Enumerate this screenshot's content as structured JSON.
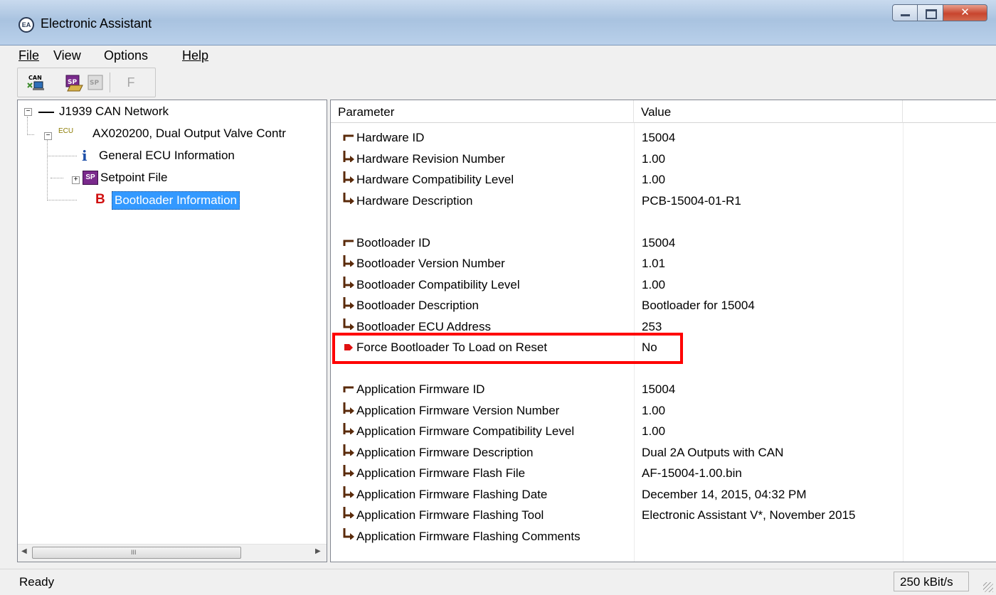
{
  "window": {
    "title": "Electronic Assistant",
    "icon_label": "EA"
  },
  "menu": {
    "file": "File",
    "view": "View",
    "options": "Options",
    "help": "Help"
  },
  "toolbar": {
    "can_label": "CAN",
    "sp_label": "SP",
    "sp_disabled_label": "SP",
    "flash_label": "F"
  },
  "tree": {
    "network": "J1939 CAN Network",
    "ecu_prefix": "ECU",
    "ecu": "AX020200, Dual Output Valve Contr",
    "general_info": "General ECU Information",
    "general_info_icon": "i",
    "setpoint_file": "Setpoint File",
    "setpoint_icon": "SP",
    "bootloader_info": "Bootloader Information",
    "bootloader_icon": "B",
    "scroll_grip": "III"
  },
  "table": {
    "header_parameter": "Parameter",
    "header_value": "Value",
    "rows": [
      {
        "param": "Hardware ID",
        "value": "15004",
        "conn": "top"
      },
      {
        "param": "Hardware Revision Number",
        "value": "1.00",
        "conn": "mid"
      },
      {
        "param": "Hardware Compatibility Level",
        "value": "1.00",
        "conn": "mid"
      },
      {
        "param": "Hardware Description",
        "value": "PCB-15004-01-R1",
        "conn": "end"
      },
      {
        "param": "",
        "value": "",
        "conn": "none"
      },
      {
        "param": "Bootloader ID",
        "value": "15004",
        "conn": "top"
      },
      {
        "param": "Bootloader Version Number",
        "value": "1.01",
        "conn": "mid"
      },
      {
        "param": "Bootloader Compatibility Level",
        "value": "1.00",
        "conn": "mid"
      },
      {
        "param": "Bootloader Description",
        "value": "Bootloader for 15004",
        "conn": "mid"
      },
      {
        "param": "Bootloader ECU Address",
        "value": "253",
        "conn": "end"
      },
      {
        "param": "Force Bootloader To Load on Reset",
        "value": "No",
        "conn": "flag"
      },
      {
        "param": "",
        "value": "",
        "conn": "none"
      },
      {
        "param": "Application Firmware ID",
        "value": "15004",
        "conn": "top"
      },
      {
        "param": "Application Firmware Version Number",
        "value": "1.00",
        "conn": "mid"
      },
      {
        "param": "Application Firmware Compatibility Level",
        "value": "1.00",
        "conn": "mid"
      },
      {
        "param": "Application Firmware Description",
        "value": "Dual 2A Outputs with CAN",
        "conn": "mid"
      },
      {
        "param": "Application Firmware Flash File",
        "value": "AF-15004-1.00.bin",
        "conn": "mid"
      },
      {
        "param": "Application Firmware Flashing Date",
        "value": "December 14, 2015, 04:32 PM",
        "conn": "mid"
      },
      {
        "param": "Application Firmware Flashing Tool",
        "value": "Electronic Assistant V*, November 2015",
        "conn": "mid"
      },
      {
        "param": "Application Firmware Flashing Comments",
        "value": "",
        "conn": "end"
      }
    ]
  },
  "status": {
    "left": "Ready",
    "baud": "250 kBit/s"
  },
  "colors": {
    "highlight_box": "#ff0000",
    "selection": "#3399ff",
    "connector": "#5a2a0a"
  }
}
